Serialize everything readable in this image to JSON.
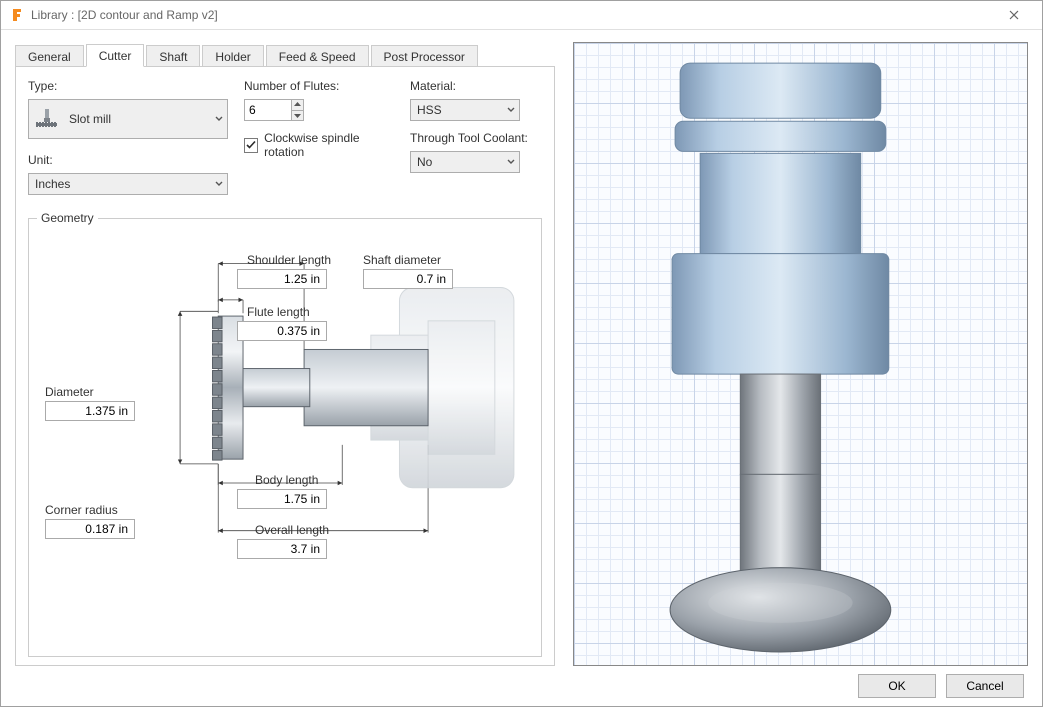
{
  "window": {
    "title": "Library : [2D contour and Ramp v2]"
  },
  "tabs": {
    "items": [
      "General",
      "Cutter",
      "Shaft",
      "Holder",
      "Feed & Speed",
      "Post Processor"
    ],
    "active": 1
  },
  "cutter": {
    "type_label": "Type:",
    "type_value": "Slot mill",
    "unit_label": "Unit:",
    "unit_value": "Inches",
    "flutes_label": "Number of Flutes:",
    "flutes_value": "6",
    "cw_label": "Clockwise spindle rotation",
    "cw_checked": true,
    "material_label": "Material:",
    "material_value": "HSS",
    "coolant_label": "Through Tool Coolant:",
    "coolant_value": "No"
  },
  "geometry": {
    "legend": "Geometry",
    "diameter_label": "Diameter",
    "diameter_value": "1.375 in",
    "corner_label": "Corner radius",
    "corner_value": "0.187 in",
    "flute_label": "Flute length",
    "flute_value": "0.375 in",
    "shoulder_label": "Shoulder length",
    "shoulder_value": "1.25 in",
    "body_label": "Body length",
    "body_value": "1.75 in",
    "overall_label": "Overall length",
    "overall_value": "3.7 in",
    "shaft_label": "Shaft diameter",
    "shaft_value": "0.7 in"
  },
  "buttons": {
    "ok": "OK",
    "cancel": "Cancel"
  }
}
